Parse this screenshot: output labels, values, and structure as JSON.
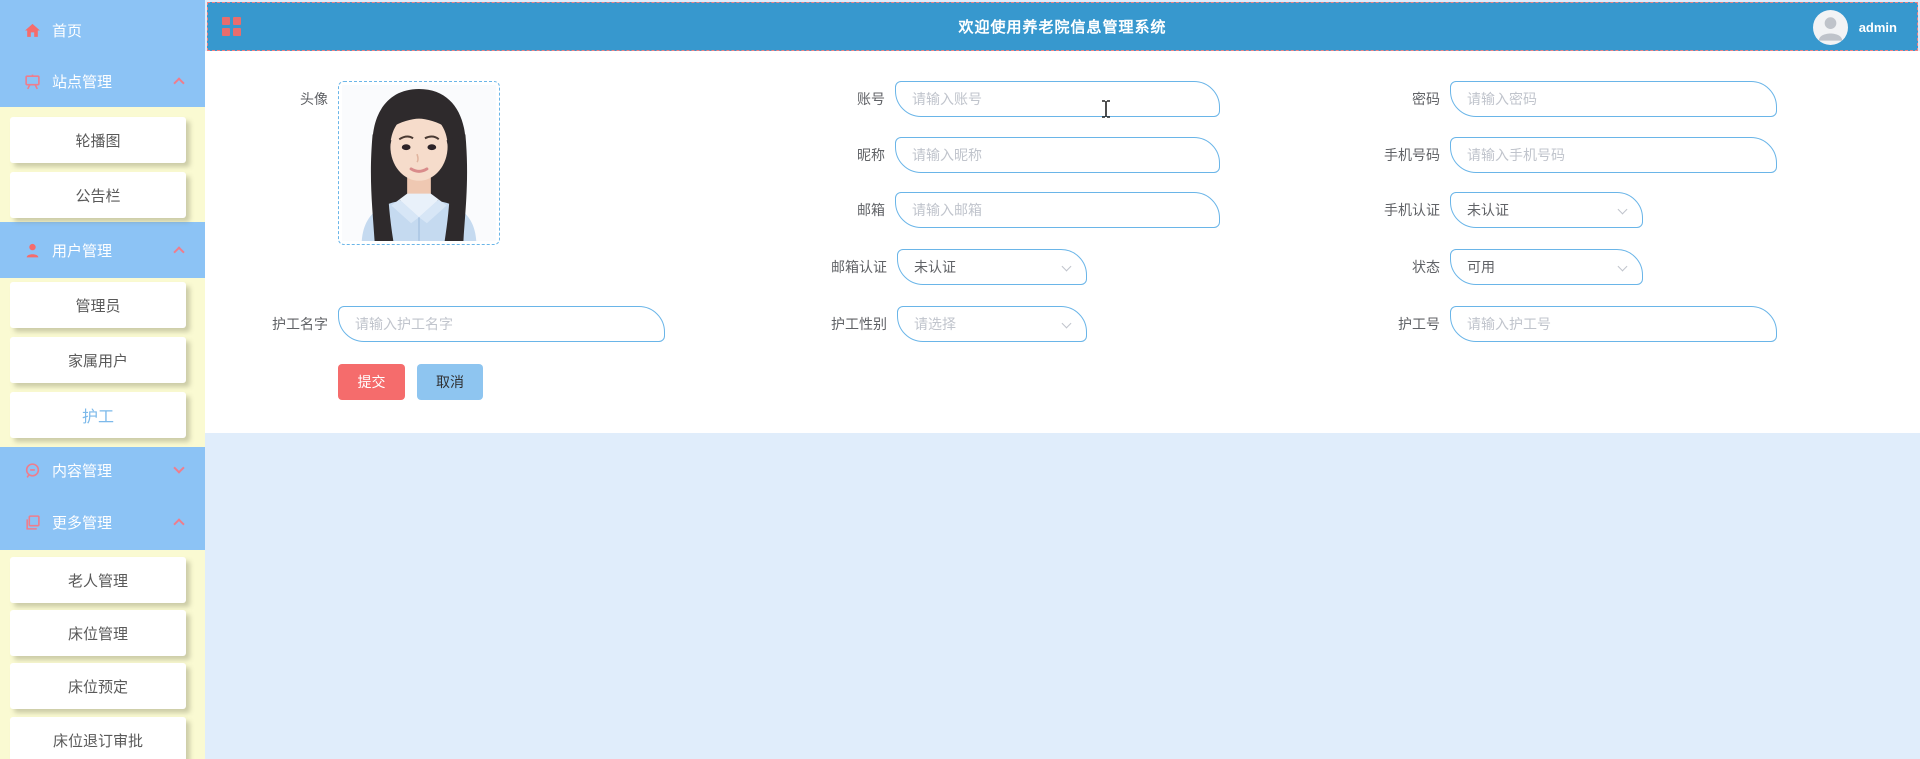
{
  "header": {
    "title": "欢迎使用养老院信息管理系统",
    "username": "admin"
  },
  "sidebar": {
    "entries": [
      {
        "label": "首页",
        "type": "group",
        "icon": "home-icon"
      },
      {
        "label": "站点管理",
        "type": "group",
        "icon": "presentation-icon",
        "state": "expanded"
      },
      {
        "label": "轮播图",
        "type": "sub"
      },
      {
        "label": "公告栏",
        "type": "sub"
      },
      {
        "label": "用户管理",
        "type": "group",
        "icon": "user-icon",
        "state": "expanded"
      },
      {
        "label": "管理员",
        "type": "sub"
      },
      {
        "label": "家属用户",
        "type": "sub"
      },
      {
        "label": "护工",
        "type": "sub",
        "active": true
      },
      {
        "label": "内容管理",
        "type": "group",
        "icon": "chat-icon",
        "state": "collapsed"
      },
      {
        "label": "更多管理",
        "type": "group",
        "icon": "copy-icon",
        "state": "expanded"
      },
      {
        "label": "老人管理",
        "type": "sub"
      },
      {
        "label": "床位管理",
        "type": "sub"
      },
      {
        "label": "床位预定",
        "type": "sub"
      },
      {
        "label": "床位退订审批",
        "type": "sub"
      }
    ]
  },
  "form": {
    "avatar_label": "头像",
    "fields": [
      {
        "label": "账号",
        "placeholder": "请输入账号"
      },
      {
        "label": "密码",
        "placeholder": "请输入密码"
      },
      {
        "label": "昵称",
        "placeholder": "请输入昵称"
      },
      {
        "label": "手机号码",
        "placeholder": "请输入手机号码"
      },
      {
        "label": "邮箱",
        "placeholder": "请输入邮箱"
      },
      {
        "label": "手机认证",
        "value": "未认证"
      },
      {
        "label": "邮箱认证",
        "value": "未认证"
      },
      {
        "label": "状态",
        "value": "可用"
      },
      {
        "label": "护工名字",
        "placeholder": "请输入护工名字"
      },
      {
        "label": "护工性别",
        "placeholder": "请选择"
      },
      {
        "label": "护工号",
        "placeholder": "请输入护工号"
      }
    ],
    "buttons": {
      "submit": "提交",
      "cancel": "取消"
    }
  },
  "colors": {
    "header_bg": "#3798ce",
    "sidebar_blue": "#8cc3f5",
    "sidebar_yellow": "#fafad2",
    "accent_red": "#f56c6c",
    "chevron_pink": "#ef7d8c",
    "input_border": "#6ab5e8",
    "active_item_blue": "#7cb9ea",
    "content_bg": "#e0edfb",
    "submit_bg": "#f56c6c",
    "cancel_bg": "#8ec5f0"
  }
}
